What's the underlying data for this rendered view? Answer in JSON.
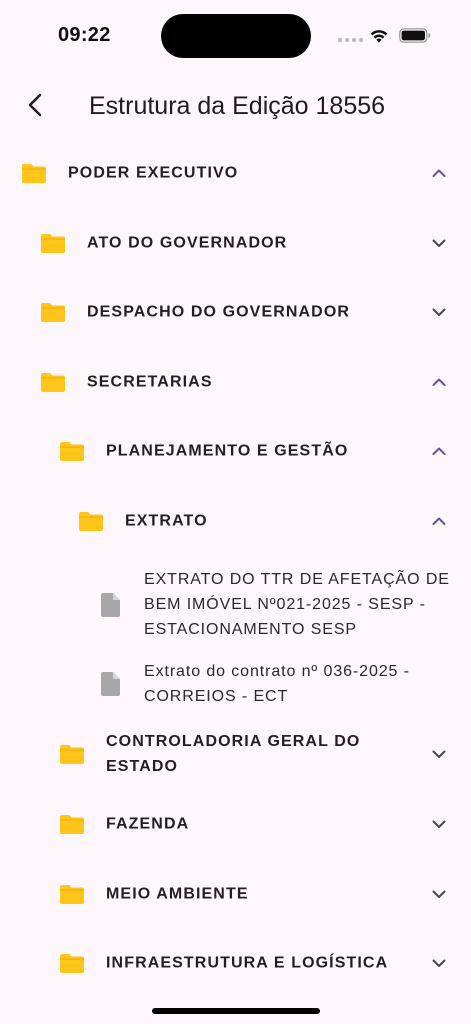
{
  "status_bar": {
    "time": "09:22",
    "icons": [
      "cellular-dots-icon",
      "wifi-icon",
      "battery-icon"
    ]
  },
  "header": {
    "title": "Estrutura da Edição 18556",
    "back_icon": "chevron-left-icon"
  },
  "colors": {
    "background": "#fdf7fb",
    "folder": "#ffc51a",
    "folder_tab": "#f1ad00",
    "chevron_expanded": "#6a51a6",
    "chevron_collapsed": "#49454f",
    "file_icon": "#a7a7a7"
  },
  "tree": {
    "poder_executivo": {
      "label": "PODER EXECUTIVO",
      "expanded": true
    },
    "ato_governador": {
      "label": "ATO DO GOVERNADOR",
      "expanded": false
    },
    "despacho_governador": {
      "label": "DESPACHO DO GOVERNADOR",
      "expanded": false
    },
    "secretarias": {
      "label": "SECRETARIAS",
      "expanded": true
    },
    "planejamento": {
      "label": "PLANEJAMENTO E GESTÃO",
      "expanded": true
    },
    "extrato": {
      "label": "EXTRATO",
      "expanded": true
    },
    "files": [
      {
        "label": "EXTRATO DO TTR DE AFETAÇÃO DE BEM IMÓVEL Nº021-2025 - SESP - ESTACIONAMENTO SESP"
      },
      {
        "label": "Extrato do contrato nº 036-2025 - CORREIOS - ECT"
      }
    ],
    "controladoria": {
      "label": "CONTROLADORIA GERAL DO ESTADO",
      "expanded": false
    },
    "fazenda": {
      "label": "FAZENDA",
      "expanded": false
    },
    "meio_ambiente": {
      "label": "MEIO AMBIENTE",
      "expanded": false
    },
    "infraestrutura": {
      "label": "INFRAESTRUTURA E LOGÍSTICA",
      "expanded": false
    }
  }
}
